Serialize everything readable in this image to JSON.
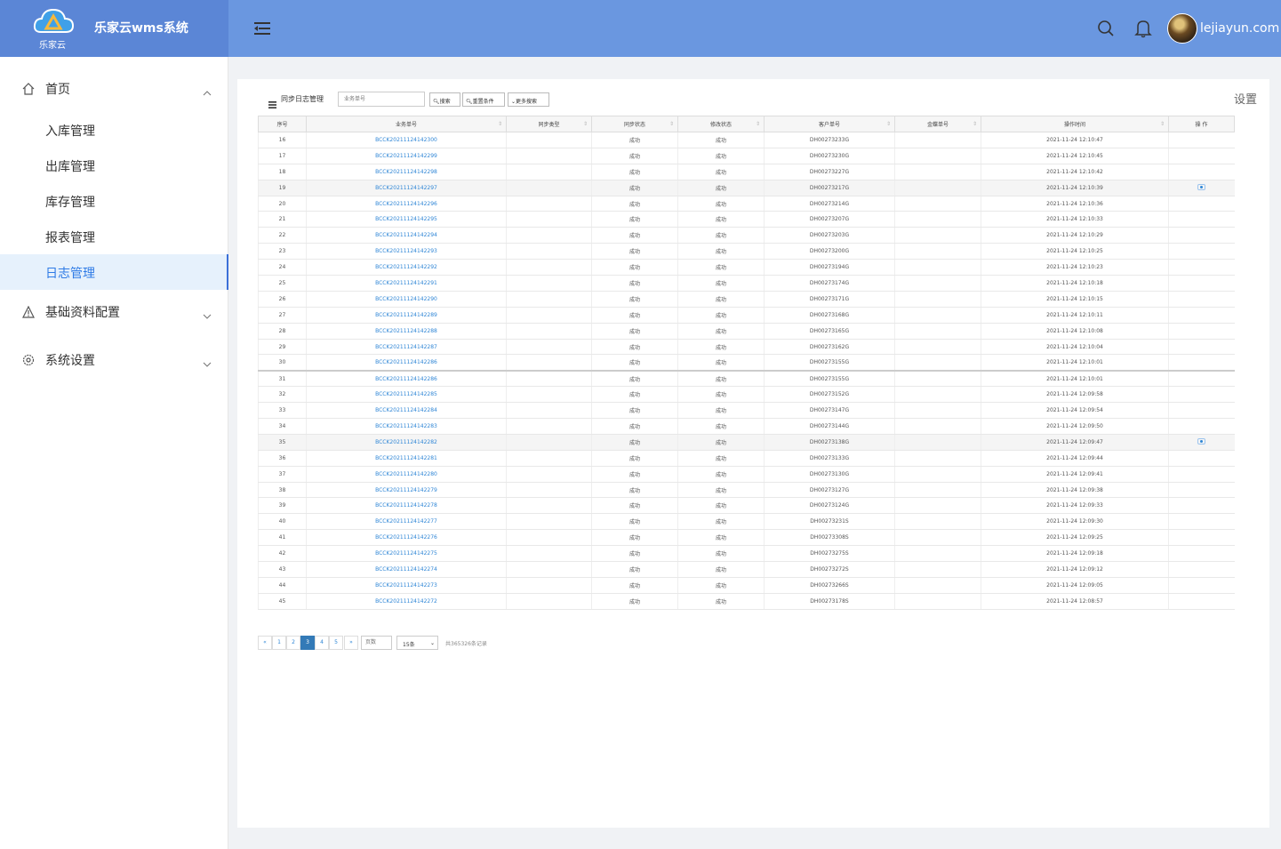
{
  "header": {
    "logo_text": "乐家云",
    "title": "乐家云wms系统",
    "username": "lejiayun.com"
  },
  "sidebar": {
    "items": [
      {
        "label": "首页",
        "icon": "home-icon",
        "expanded": true
      },
      {
        "label": "入库管理"
      },
      {
        "label": "出库管理"
      },
      {
        "label": "库存管理"
      },
      {
        "label": "报表管理"
      },
      {
        "label": "日志管理",
        "active": true
      },
      {
        "label": "基础资料配置",
        "icon": "warning-icon"
      },
      {
        "label": "系统设置",
        "icon": "gear-icon"
      }
    ]
  },
  "panel": {
    "settings_label": "设置",
    "toolbar": {
      "title": "同步日志管理",
      "search_placeholder": "业务单号",
      "search_btn": "搜索",
      "reset_btn": "重置条件",
      "more_btn": "更多搜索"
    }
  },
  "table": {
    "headers": [
      "序号",
      "业务单号",
      "同步类型",
      "同步状态",
      "修改状态",
      "客户单号",
      "金蝶单号",
      "操作时间",
      "操 作"
    ],
    "rows": [
      [
        "16",
        "BCCK20211124142300",
        "",
        "成功",
        "成功",
        "DH00273233G",
        "",
        "2021-11-24 12:10:47"
      ],
      [
        "17",
        "BCCK20211124142299",
        "",
        "成功",
        "成功",
        "DH00273230G",
        "",
        "2021-11-24 12:10:45"
      ],
      [
        "18",
        "BCCK20211124142298",
        "",
        "成功",
        "成功",
        "DH00273227G",
        "",
        "2021-11-24 12:10:42"
      ],
      [
        "19",
        "BCCK20211124142297",
        "",
        "成功",
        "成功",
        "DH00273217G",
        "",
        "2021-11-24 12:10:39"
      ],
      [
        "20",
        "BCCK20211124142296",
        "",
        "成功",
        "成功",
        "DH00273214G",
        "",
        "2021-11-24 12:10:36"
      ],
      [
        "21",
        "BCCK20211124142295",
        "",
        "成功",
        "成功",
        "DH00273207G",
        "",
        "2021-11-24 12:10:33"
      ],
      [
        "22",
        "BCCK20211124142294",
        "",
        "成功",
        "成功",
        "DH00273203G",
        "",
        "2021-11-24 12:10:29"
      ],
      [
        "23",
        "BCCK20211124142293",
        "",
        "成功",
        "成功",
        "DH00273200G",
        "",
        "2021-11-24 12:10:25"
      ],
      [
        "24",
        "BCCK20211124142292",
        "",
        "成功",
        "成功",
        "DH00273194G",
        "",
        "2021-11-24 12:10:23"
      ],
      [
        "25",
        "BCCK20211124142291",
        "",
        "成功",
        "成功",
        "DH00273174G",
        "",
        "2021-11-24 12:10:18"
      ],
      [
        "26",
        "BCCK20211124142290",
        "",
        "成功",
        "成功",
        "DH00273171G",
        "",
        "2021-11-24 12:10:15"
      ],
      [
        "27",
        "BCCK20211124142289",
        "",
        "成功",
        "成功",
        "DH00273168G",
        "",
        "2021-11-24 12:10:11"
      ],
      [
        "28",
        "BCCK20211124142288",
        "",
        "成功",
        "成功",
        "DH00273165G",
        "",
        "2021-11-24 12:10:08"
      ],
      [
        "29",
        "BCCK20211124142287",
        "",
        "成功",
        "成功",
        "DH00273162G",
        "",
        "2021-11-24 12:10:04"
      ],
      [
        "30",
        "BCCK20211124142286",
        "",
        "成功",
        "成功",
        "DH00273155G",
        "",
        "2021-11-24 12:10:01"
      ],
      [
        "31",
        "BCCK20211124142286",
        "",
        "成功",
        "成功",
        "DH00273155G",
        "",
        "2021-11-24 12:10:01"
      ],
      [
        "32",
        "BCCK20211124142285",
        "",
        "成功",
        "成功",
        "DH00273152G",
        "",
        "2021-11-24 12:09:58"
      ],
      [
        "33",
        "BCCK20211124142284",
        "",
        "成功",
        "成功",
        "DH00273147G",
        "",
        "2021-11-24 12:09:54"
      ],
      [
        "34",
        "BCCK20211124142283",
        "",
        "成功",
        "成功",
        "DH00273144G",
        "",
        "2021-11-24 12:09:50"
      ],
      [
        "35",
        "BCCK20211124142282",
        "",
        "成功",
        "成功",
        "DH00273138G",
        "",
        "2021-11-24 12:09:47"
      ],
      [
        "36",
        "BCCK20211124142281",
        "",
        "成功",
        "成功",
        "DH00273133G",
        "",
        "2021-11-24 12:09:44"
      ],
      [
        "37",
        "BCCK20211124142280",
        "",
        "成功",
        "成功",
        "DH00273130G",
        "",
        "2021-11-24 12:09:41"
      ],
      [
        "38",
        "BCCK20211124142279",
        "",
        "成功",
        "成功",
        "DH00273127G",
        "",
        "2021-11-24 12:09:38"
      ],
      [
        "39",
        "BCCK20211124142278",
        "",
        "成功",
        "成功",
        "DH00273124G",
        "",
        "2021-11-24 12:09:33"
      ],
      [
        "40",
        "BCCK20211124142277",
        "",
        "成功",
        "成功",
        "DH00273231S",
        "",
        "2021-11-24 12:09:30"
      ],
      [
        "41",
        "BCCK20211124142276",
        "",
        "成功",
        "成功",
        "DH00273308S",
        "",
        "2021-11-24 12:09:25"
      ],
      [
        "42",
        "BCCK20211124142275",
        "",
        "成功",
        "成功",
        "DH00273275S",
        "",
        "2021-11-24 12:09:18"
      ],
      [
        "43",
        "BCCK20211124142274",
        "",
        "成功",
        "成功",
        "DH00273272S",
        "",
        "2021-11-24 12:09:12"
      ],
      [
        "44",
        "BCCK20211124142273",
        "",
        "成功",
        "成功",
        "DH00273266S",
        "",
        "2021-11-24 12:09:05"
      ],
      [
        "45",
        "BCCK20211124142272",
        "",
        "成功",
        "成功",
        "DH00273178S",
        "",
        "2021-11-24 12:08:57"
      ]
    ],
    "eye_rows": [
      "19",
      "35"
    ],
    "highlight_rows": [
      "19",
      "35"
    ]
  },
  "pager": {
    "prev": "«",
    "pages": [
      "1",
      "2",
      "3",
      "4",
      "5"
    ],
    "current": "3",
    "next": "»",
    "page_input_placeholder": "页数",
    "page_size": "15条",
    "total": "共365326条记录"
  },
  "colors": {
    "topbar": "#6a97e0",
    "brand": "#5b86d6",
    "link": "#2f86d6",
    "active_bg": "#e6f1fc"
  }
}
